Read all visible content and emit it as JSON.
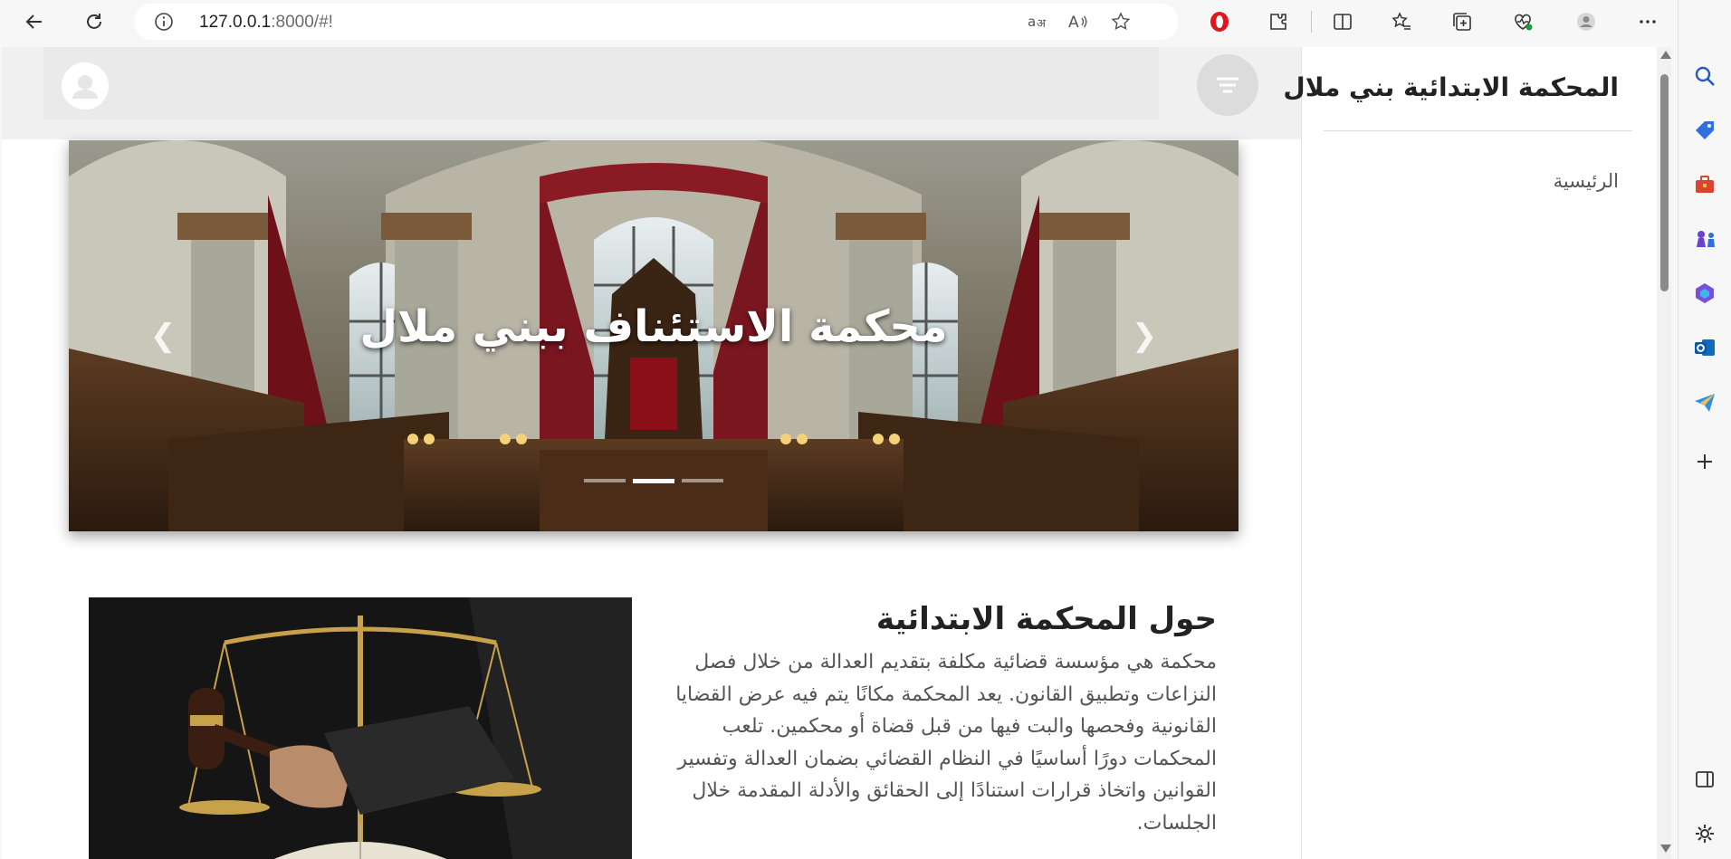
{
  "browser": {
    "url_host": "127.0.0.1",
    "url_rest": ":8000/#!",
    "translate_icon": "translate-icon",
    "read_aloud_icon": "read-aloud-icon"
  },
  "header": {
    "avatar_icon": "user-avatar-icon",
    "menu_icon": "menu-toggle-icon"
  },
  "hero": {
    "caption": "محكمة الاستئناف ببني ملال",
    "prev_glyph": "❮",
    "next_glyph": "❯",
    "slides_count": 3,
    "active_slide": 2
  },
  "about": {
    "title": "حول المحكمة الابتدائية",
    "body": "محكمة هي مؤسسة قضائية مكلفة بتقديم العدالة من خلال فصل النزاعات وتطبيق القانون. يعد المحكمة مكانًا يتم فيه عرض القضايا القانونية وفحصها والبت فيها من قبل قضاة أو محكمين. تلعب المحكمات دورًا أساسيًا في النظام القضائي بضمان العدالة وتفسير القوانين واتخاذ قرارات استنادًا إلى الحقائق والأدلة المقدمة خلال الجلسات."
  },
  "drawer": {
    "title": "المحكمة الابتدائية بني ملال",
    "links": [
      {
        "label": "الرئيسية"
      }
    ]
  },
  "colors": {
    "browser_bg": "#f7f7f7",
    "header_bg": "#f0f0f0",
    "accent_red": "#e0161b"
  }
}
